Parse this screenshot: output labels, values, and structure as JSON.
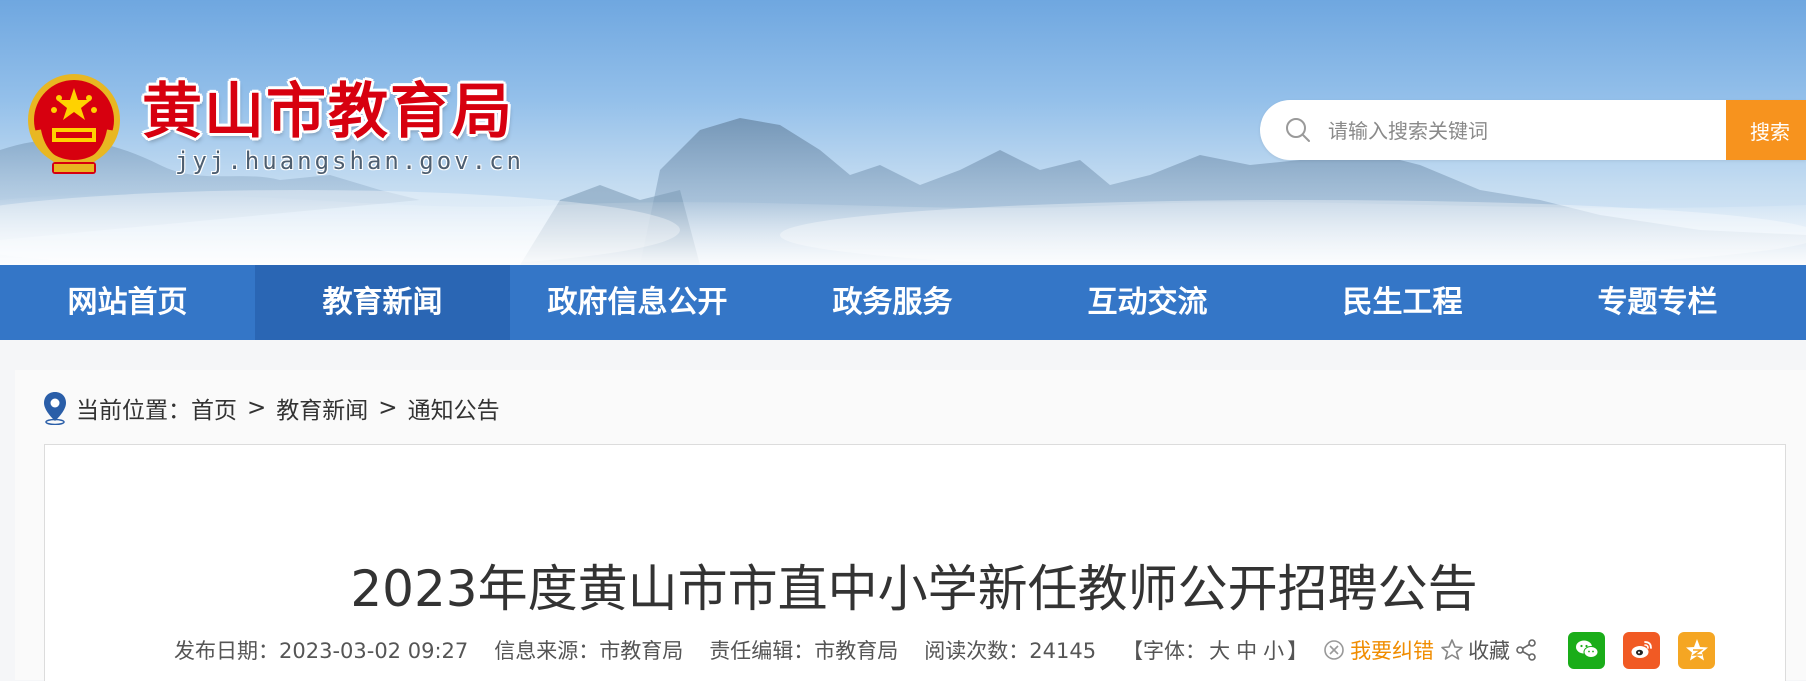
{
  "site": {
    "title": "黄山市教育局",
    "domain": "jyj.huangshan.gov.cn"
  },
  "search": {
    "placeholder": "请输入搜索关键词",
    "button_label": "搜索"
  },
  "nav": {
    "items": [
      {
        "label": "网站首页"
      },
      {
        "label": "教育新闻"
      },
      {
        "label": "政府信息公开"
      },
      {
        "label": "政务服务"
      },
      {
        "label": "互动交流"
      },
      {
        "label": "民生工程"
      },
      {
        "label": "专题专栏"
      }
    ],
    "active_label": "教育新闻"
  },
  "breadcrumb": {
    "prefix": "当前位置：",
    "items": [
      {
        "label": "首页"
      },
      {
        "label": "教育新闻"
      },
      {
        "label": "通知公告"
      }
    ],
    "separator": ">"
  },
  "article": {
    "title": "2023年度黄山市市直中小学新任教师公开招聘公告",
    "publish_date": "发布日期：2023-03-02 09:27",
    "source": "信息来源：市教育局",
    "editor": "责任编辑：市教育局",
    "views": "阅读次数：24145",
    "font_label_open": "【字体：",
    "font_large": "大",
    "font_medium": "中",
    "font_small": "小",
    "font_label_close": "】",
    "correct_label": "我要纠错",
    "favorite_label": "收藏"
  },
  "colors": {
    "nav_bg": "#3476c7",
    "nav_active": "#2a66b4",
    "title_red": "#d7000f",
    "search_button": "#f7931e",
    "wechat": "#1aad19",
    "weibo": "#f15a24",
    "qzone": "#f5a623"
  },
  "icons": {
    "emblem": "national-emblem",
    "search": "search-icon",
    "location": "location-pin-icon",
    "correct": "error-x-icon",
    "favorite": "star-outline-icon",
    "share": "share-icon",
    "wechat": "wechat-icon",
    "weibo": "weibo-icon",
    "qzone": "qzone-star-icon"
  }
}
